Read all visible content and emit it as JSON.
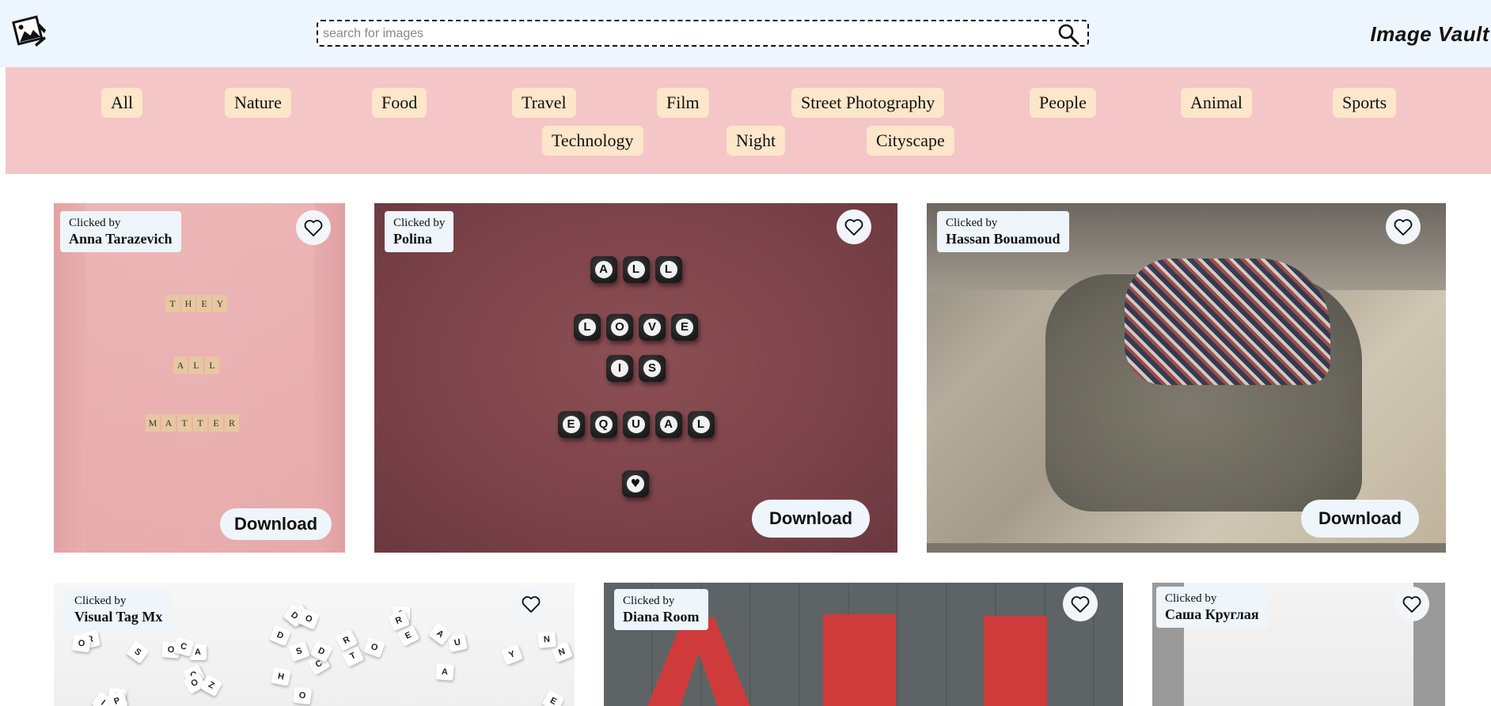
{
  "header": {
    "brand": "Image Vault",
    "search_placeholder": "search for images",
    "search_value": ""
  },
  "categories": [
    "All",
    "Nature",
    "Food",
    "Travel",
    "Film",
    "Street Photography",
    "People",
    "Animal",
    "Sports",
    "Technology",
    "Night",
    "Cityscape"
  ],
  "cards": [
    {
      "credit_label": "Clicked by",
      "photographer": "Anna Tarazevich",
      "download_label": "Download",
      "tiles": [
        "THEY",
        "ALL",
        "MATTER"
      ]
    },
    {
      "credit_label": "Clicked by",
      "photographer": "Polina",
      "download_label": "Download",
      "beads": [
        "ALL",
        "LOVE",
        "IS",
        "EQUAL"
      ]
    },
    {
      "credit_label": "Clicked by",
      "photographer": "Hassan Bouamoud",
      "download_label": "Download"
    },
    {
      "credit_label": "Clicked by",
      "photographer": "Visual Tag Mx"
    },
    {
      "credit_label": "Clicked by",
      "photographer": "Diana Room"
    },
    {
      "credit_label": "Clicked by",
      "photographer": "Саша Круглая"
    }
  ],
  "icons": {
    "logo": "photos-stack-icon",
    "search": "magnifier-icon",
    "like": "heart-outline-icon"
  },
  "colors": {
    "header_bg": "#edf5ff",
    "category_bar_bg": "#f5c6c8",
    "chip_bg": "#fde6c9",
    "overlay_bg": "#eef5fb"
  }
}
